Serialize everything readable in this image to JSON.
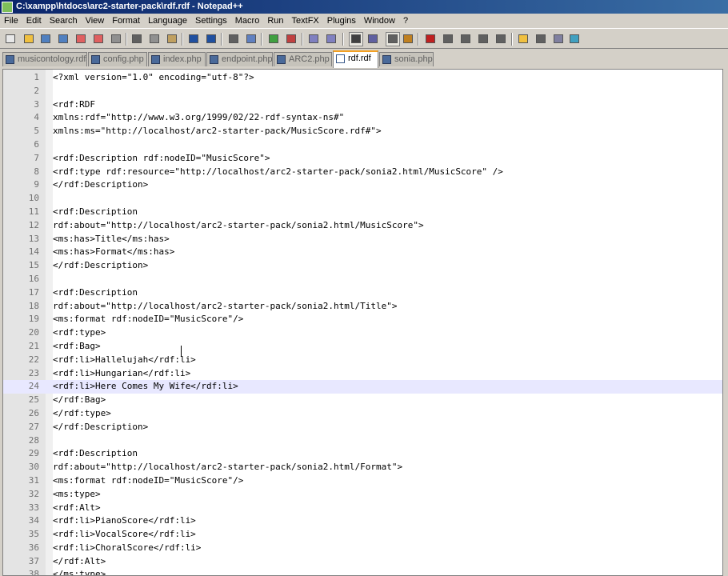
{
  "window": {
    "title": "C:\\xampp\\htdocs\\arc2-starter-pack\\rdf.rdf - Notepad++"
  },
  "menu": [
    "File",
    "Edit",
    "Search",
    "View",
    "Format",
    "Language",
    "Settings",
    "Macro",
    "Run",
    "TextFX",
    "Plugins",
    "Window",
    "?"
  ],
  "toolbar": {
    "buttons": [
      "new-file",
      "open-file",
      "save",
      "save-all",
      "close",
      "close-all",
      "print",
      "cut",
      "copy",
      "paste",
      "undo",
      "redo",
      "find",
      "replace",
      "zoom-in",
      "zoom-out",
      "sync-vertical",
      "sync-horizontal",
      "word-wrap",
      "show-all-chars",
      "indent-guide",
      "user-defined-language",
      "record-macro",
      "stop-recording",
      "play-macro",
      "run-macro-multiple",
      "save-macro",
      "open-folder",
      "panel",
      "launch-in-browser",
      "spell-check"
    ],
    "active": [
      "word-wrap",
      "indent-guide"
    ]
  },
  "tabs": [
    {
      "label": "musicontology.rdfs",
      "active": false
    },
    {
      "label": "config.php",
      "active": false
    },
    {
      "label": "index.php",
      "active": false
    },
    {
      "label": "endpoint.php",
      "active": false
    },
    {
      "label": "ARC2.php",
      "active": false
    },
    {
      "label": "rdf.rdf",
      "active": true
    },
    {
      "label": "sonia.php",
      "active": false
    }
  ],
  "editor": {
    "lines": [
      {
        "n": "1",
        "text": "<?xml version=\"1.0\" encoding=\"utf-8\"?>"
      },
      {
        "n": "2",
        "text": ""
      },
      {
        "n": "3",
        "text": "<rdf:RDF"
      },
      {
        "n": "4",
        "text": "xmlns:rdf=\"http://www.w3.org/1999/02/22-rdf-syntax-ns#\""
      },
      {
        "n": "5",
        "text": "xmlns:ms=\"http://localhost/arc2-starter-pack/MusicScore.rdf#\">"
      },
      {
        "n": "6",
        "text": ""
      },
      {
        "n": "7",
        "text": "<rdf:Description rdf:nodeID=\"MusicScore\">"
      },
      {
        "n": "8",
        "text": "<rdf:type rdf:resource=\"http://localhost/arc2-starter-pack/sonia2.html/MusicScore\" />"
      },
      {
        "n": "9",
        "text": "</rdf:Description>"
      },
      {
        "n": "10",
        "text": ""
      },
      {
        "n": "11",
        "text": "<rdf:Description"
      },
      {
        "n": "12",
        "text": "rdf:about=\"http://localhost/arc2-starter-pack/sonia2.html/MusicScore\">"
      },
      {
        "n": "13",
        "text": "<ms:has>Title</ms:has>"
      },
      {
        "n": "14",
        "text": "<ms:has>Format</ms:has>"
      },
      {
        "n": "15",
        "text": "</rdf:Description>"
      },
      {
        "n": "16",
        "text": ""
      },
      {
        "n": "17",
        "text": "<rdf:Description"
      },
      {
        "n": "18",
        "text": "rdf:about=\"http://localhost/arc2-starter-pack/sonia2.html/Title\">"
      },
      {
        "n": "19",
        "text": "<ms:format rdf:nodeID=\"MusicScore\"/>"
      },
      {
        "n": "20",
        "text": "<rdf:type>"
      },
      {
        "n": "21",
        "text": "<rdf:Bag>"
      },
      {
        "n": "22",
        "text": "<rdf:li>Hallelujah</rdf:li>"
      },
      {
        "n": "23",
        "text": "<rdf:li>Hungarian</rdf:li>"
      },
      {
        "n": "24",
        "text": "<rdf:li>Here Comes My Wife</rdf:li>"
      },
      {
        "n": "25",
        "text": "</rdf:Bag>"
      },
      {
        "n": "26",
        "text": "</rdf:type>"
      },
      {
        "n": "27",
        "text": "</rdf:Description>"
      },
      {
        "n": "28",
        "text": ""
      },
      {
        "n": "29",
        "text": "<rdf:Description"
      },
      {
        "n": "30",
        "text": "rdf:about=\"http://localhost/arc2-starter-pack/sonia2.html/Format\">"
      },
      {
        "n": "31",
        "text": "<ms:format rdf:nodeID=\"MusicScore\"/>"
      },
      {
        "n": "32",
        "text": "<ms:type>"
      },
      {
        "n": "33",
        "text": "<rdf:Alt>"
      },
      {
        "n": "34",
        "text": "<rdf:li>PianoScore</rdf:li>"
      },
      {
        "n": "35",
        "text": "<rdf:li>VocalScore</rdf:li>"
      },
      {
        "n": "36",
        "text": "<rdf:li>ChoralScore</rdf:li>"
      },
      {
        "n": "37",
        "text": "</rdf:Alt>"
      },
      {
        "n": "38",
        "text": "</ms:type>"
      }
    ],
    "current_line": "24"
  }
}
